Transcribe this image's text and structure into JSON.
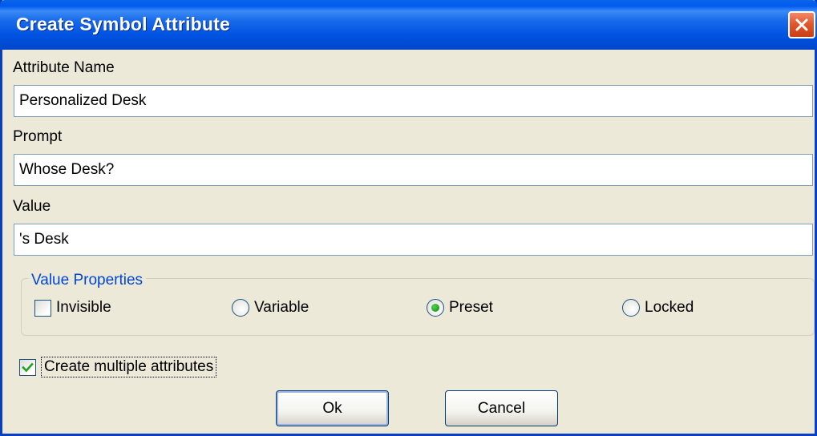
{
  "window": {
    "title": "Create Symbol Attribute"
  },
  "icons": {
    "close": "close-icon",
    "checkmark": "checkmark-icon"
  },
  "colors": {
    "title_bar": "#0058EE",
    "group_legend": "#0046D5",
    "close_button": "#E2582E",
    "check_green": "#21A121"
  },
  "fields": {
    "attribute_name": {
      "label": "Attribute Name",
      "value": "Personalized Desk"
    },
    "prompt": {
      "label": "Prompt",
      "value": "Whose Desk?"
    },
    "value": {
      "label": "Value",
      "value": "'s Desk"
    }
  },
  "value_properties": {
    "legend": "Value Properties",
    "invisible": {
      "label": "Invisible",
      "checked": false
    },
    "radios": [
      {
        "label": "Variable",
        "selected": false
      },
      {
        "label": "Preset",
        "selected": true
      },
      {
        "label": "Locked",
        "selected": false
      }
    ]
  },
  "multiple": {
    "label": "Create multiple attributes",
    "checked": true
  },
  "buttons": {
    "ok": "Ok",
    "cancel": "Cancel"
  }
}
